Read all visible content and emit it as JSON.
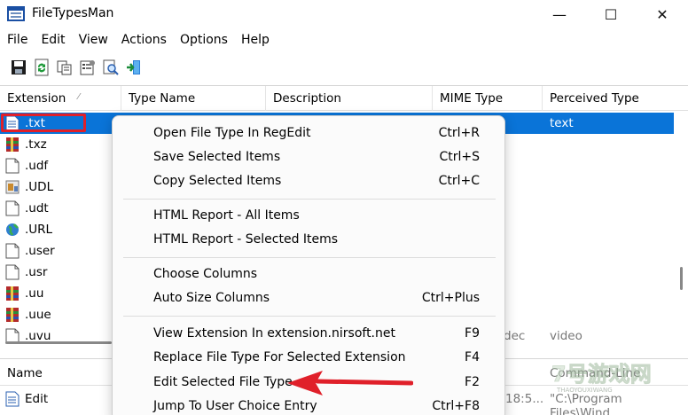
{
  "window": {
    "title": "FileTypesMan",
    "minimize_label": "—",
    "maximize_label": "☐",
    "close_label": "✕"
  },
  "menu": [
    "File",
    "Edit",
    "View",
    "Actions",
    "Options",
    "Help"
  ],
  "toolbar": {
    "icons": [
      "save-icon",
      "refresh-icon",
      "copy-icon",
      "properties-icon",
      "find-icon",
      "exit-icon"
    ]
  },
  "columns": {
    "extension": "Extension",
    "sort_indicator": "⁄",
    "type_name": "Type Name",
    "description": "Description",
    "mime_type": "MIME Type",
    "perceived_type": "Perceived Type"
  },
  "rows": [
    {
      "ext": ".txt",
      "icon": "text-file-icon",
      "perceived": "text"
    },
    {
      "ext": ".txz",
      "icon": "archive-icon"
    },
    {
      "ext": ".udf",
      "icon": "blank-file-icon"
    },
    {
      "ext": ".UDL",
      "icon": "data-link-icon"
    },
    {
      "ext": ".udt",
      "icon": "blank-file-icon"
    },
    {
      "ext": ".URL",
      "icon": "globe-icon"
    },
    {
      "ext": ".user",
      "icon": "blank-file-icon"
    },
    {
      "ext": ".usr",
      "icon": "blank-file-icon"
    },
    {
      "ext": ".uu",
      "icon": "archive-icon"
    },
    {
      "ext": ".uue",
      "icon": "archive-icon"
    },
    {
      "ext": ".uvu",
      "icon": "blank-file-icon",
      "desc_partial": "dec",
      "perceived": "video"
    }
  ],
  "context_menu": {
    "groups": [
      [
        {
          "label": "Open File Type In RegEdit",
          "shortcut": "Ctrl+R"
        },
        {
          "label": "Save Selected Items",
          "shortcut": "Ctrl+S"
        },
        {
          "label": "Copy Selected Items",
          "shortcut": "Ctrl+C"
        }
      ],
      [
        {
          "label": "HTML Report - All Items",
          "shortcut": ""
        },
        {
          "label": "HTML Report - Selected Items",
          "shortcut": ""
        }
      ],
      [
        {
          "label": "Choose Columns",
          "shortcut": ""
        },
        {
          "label": "Auto Size Columns",
          "shortcut": "Ctrl+Plus"
        }
      ],
      [
        {
          "label": "View Extension In extension.nirsoft.net",
          "shortcut": "F9"
        },
        {
          "label": "Replace File Type For Selected Extension",
          "shortcut": "F4"
        },
        {
          "label": "Edit Selected File Type",
          "shortcut": "F2"
        },
        {
          "label": "Jump To User Choice Entry",
          "shortcut": "Ctrl+F8"
        }
      ]
    ]
  },
  "lower_pane": {
    "columns": {
      "name": "Name",
      "command_line": "Command-Line"
    },
    "rows": [
      {
        "name": "Edit",
        "time_partial": "18:5...",
        "command": "\"C:\\Program Files\\Wind"
      }
    ]
  },
  "watermark": {
    "brand": "7号游戏网",
    "sub": "THAOYOUXIWANG"
  },
  "colors": {
    "selection": "#0a74d8",
    "highlight": "#e0202a",
    "arrow": "#e0202a"
  }
}
